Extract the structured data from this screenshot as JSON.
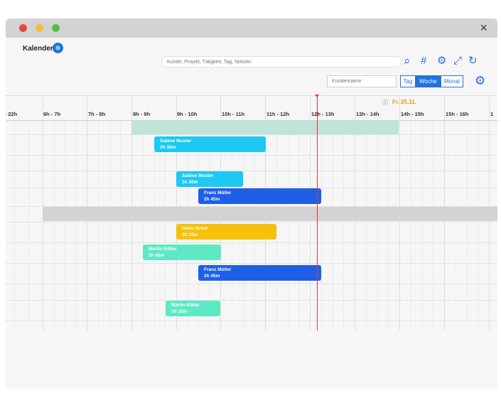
{
  "window": {
    "title": "Kalender",
    "close_icon": "×"
  },
  "traffic_lights": [
    {
      "name": "close",
      "color": "#e24b3b"
    },
    {
      "name": "minimize",
      "color": "#f0bf3a"
    },
    {
      "name": "maximize",
      "color": "#57be45"
    }
  ],
  "toolbar": {
    "search_placeholder": "Kunde, Projekt, Tätigkeit, Tag, Notizen",
    "customer_placeholder": "Kundenname",
    "icons": {
      "search": "⌕",
      "hashtag": "#",
      "settings": "⚙",
      "fullscreen": "⤢",
      "refresh": "↻",
      "view_settings": "⚙",
      "logo": "⊕"
    },
    "view_buttons": [
      {
        "label": "Tag",
        "active": false
      },
      {
        "label": "Woche",
        "active": true
      },
      {
        "label": "Monat",
        "active": false
      }
    ]
  },
  "timeline": {
    "info_icon": "ⓘ",
    "date_label": "Fr. 25.11.",
    "hours": [
      "h - 22h",
      "6h - 7h",
      "7h - 8h",
      "8h - 9h",
      "9h - 10h",
      "10h - 11h",
      "11h - 12h",
      "12h - 13h",
      "13h - 14h",
      "14h - 15h",
      "15h - 16h",
      "1"
    ],
    "now_color": "#e33333",
    "band_colors": {
      "availability": "#bfe3d6",
      "blocked": "#d3d3d3"
    }
  },
  "events": [
    {
      "name": "Sabine Muster",
      "duration": "2h 30m",
      "color": "#1ec8f2"
    },
    {
      "name": "Sabine Muster",
      "duration": "1h 30m",
      "color": "#1ec8f2"
    },
    {
      "name": "Franz Müller",
      "duration": "2h 45m",
      "color": "#1f5fe6"
    },
    {
      "name": "Heinz Ernst",
      "duration": "2h 15m",
      "color": "#f7c10a"
    },
    {
      "name": "Martin Köller",
      "duration": "1h 45m",
      "color": "#5ee9c4"
    },
    {
      "name": "Franz Müller",
      "duration": "2h 45m",
      "color": "#1f5fe6"
    },
    {
      "name": "Martin Köller",
      "duration": "1h 15m",
      "color": "#5ee9c4"
    }
  ]
}
